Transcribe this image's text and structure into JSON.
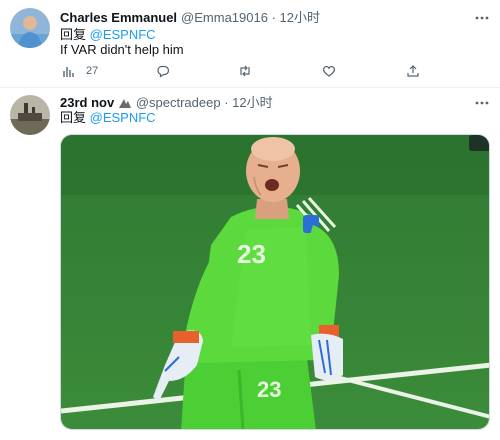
{
  "tweets": [
    {
      "author": "Charles Emmanuel",
      "handle": "@Emma19016",
      "separator": "·",
      "time": "12小时",
      "reply_prefix": "回复",
      "reply_mention": "@ESPNFC",
      "text": "If VAR didn't help him",
      "actions": {
        "analytics_count": "27"
      },
      "icons": [
        "analytics-icon",
        "reply-icon",
        "retweet-icon",
        "like-icon",
        "share-icon",
        "more-icon"
      ]
    },
    {
      "author": "23rd nov",
      "handle": "@spectradeep",
      "separator": "·",
      "time": "12小时",
      "reply_prefix": "回复",
      "reply_mention": "@ESPNFC",
      "media": {
        "shirt_number": "23"
      }
    }
  ],
  "colors": {
    "accent": "#1d9bf0",
    "secondary_text": "#536471",
    "pitch": "#2e7d32",
    "kit": "#5cd93c"
  }
}
